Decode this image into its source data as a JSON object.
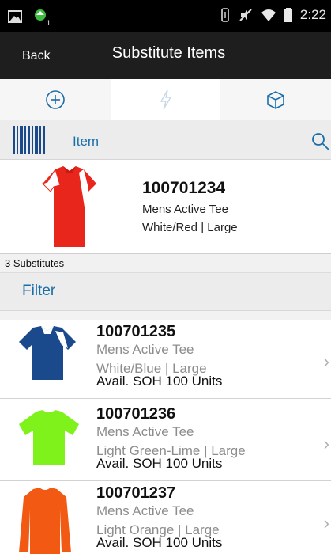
{
  "status_bar": {
    "time": "2:22",
    "notification_badge": "1"
  },
  "app_bar": {
    "back_label": "Back",
    "title": "Substitute Items"
  },
  "tabs": [
    {
      "icon": "add-circle-icon",
      "active": false
    },
    {
      "icon": "lightning-icon",
      "active": true
    },
    {
      "icon": "box-icon",
      "active": false
    }
  ],
  "scan": {
    "label": "Item"
  },
  "header_item": {
    "number": "100701234",
    "description": "Mens Active Tee",
    "attributes": "White/Red | Large",
    "colors": {
      "body": "#e8261c",
      "accent": "#ffffff"
    }
  },
  "substitutes_count": "3 Substitutes",
  "filter_label": "Filter",
  "rows": [
    {
      "number": "100701235",
      "description": "Mens Active Tee",
      "attributes": "White/Blue | Large",
      "soh": "Avail. SOH 100 Units",
      "colors": {
        "body": "#1a4a8c",
        "accent": "#ffffff"
      }
    },
    {
      "number": "100701236",
      "description": "Mens Active Tee",
      "attributes": "Light Green-Lime | Large",
      "soh": "Avail. SOH 100 Units",
      "colors": {
        "body": "#7ff21c",
        "accent": "#7ff21c"
      }
    },
    {
      "number": "100701237",
      "description": "Mens Active Tee",
      "attributes": "Light Orange | Large",
      "soh": "Avail. SOH 100 Units",
      "colors": {
        "body": "#f25a14",
        "accent": "#f25a14"
      }
    }
  ],
  "theme": {
    "link_color": "#1a6ea8",
    "app_bar": "#1e1e1e"
  }
}
